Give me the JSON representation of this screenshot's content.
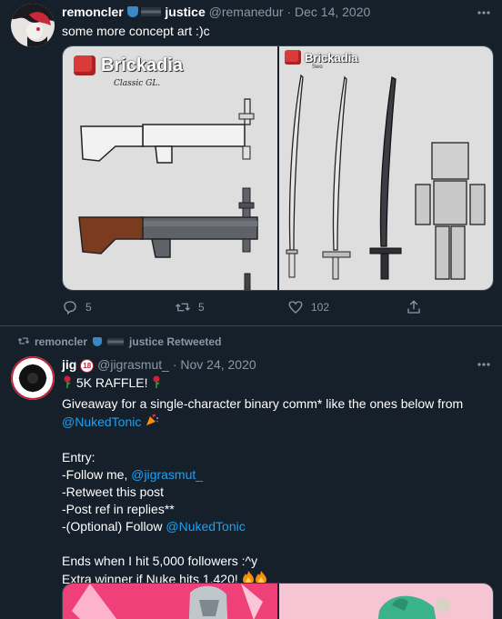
{
  "tweet1": {
    "author_name": "remoncler",
    "author_name_suffix": "justice",
    "handle": "@remanedur",
    "separator": "·",
    "date": "Dec 14, 2020",
    "text": "some more concept art :)c",
    "media": {
      "left_logo": "Brickadia",
      "left_caption": "Classic GL.",
      "right_logo": "Brickadia",
      "right_caption": "Swo"
    },
    "actions": {
      "replies": "5",
      "retweets": "5",
      "likes": "102"
    }
  },
  "tweet2": {
    "retweet_context_name": "remoncler",
    "retweet_context_suffix": "justice Retweeted",
    "author_name": "jig",
    "badge": "18",
    "handle": "@jigrasmut_",
    "separator": "·",
    "date": "Nov 24, 2020",
    "line1": "5K RAFFLE!",
    "line2_text": "Giveaway for a single-character binary comm* like the ones below from",
    "line3_link": "@NukedTonic",
    "entry_heading": "Entry:",
    "entry1_prefix": "-Follow me, ",
    "entry1_link": "@jigrasmut_",
    "entry2": "-Retweet this post",
    "entry3": "-Post ref in replies**",
    "entry4_prefix": "-(Optional) Follow ",
    "entry4_link": "@NukedTonic",
    "ends_line": "Ends when I hit 5,000 followers :^y",
    "extra_line": "Extra winner if Nuke hits 1,420!"
  },
  "colors": {
    "background": "#15202b",
    "link": "#1da1f2",
    "muted": "#8899a6",
    "divider": "#38444d"
  }
}
